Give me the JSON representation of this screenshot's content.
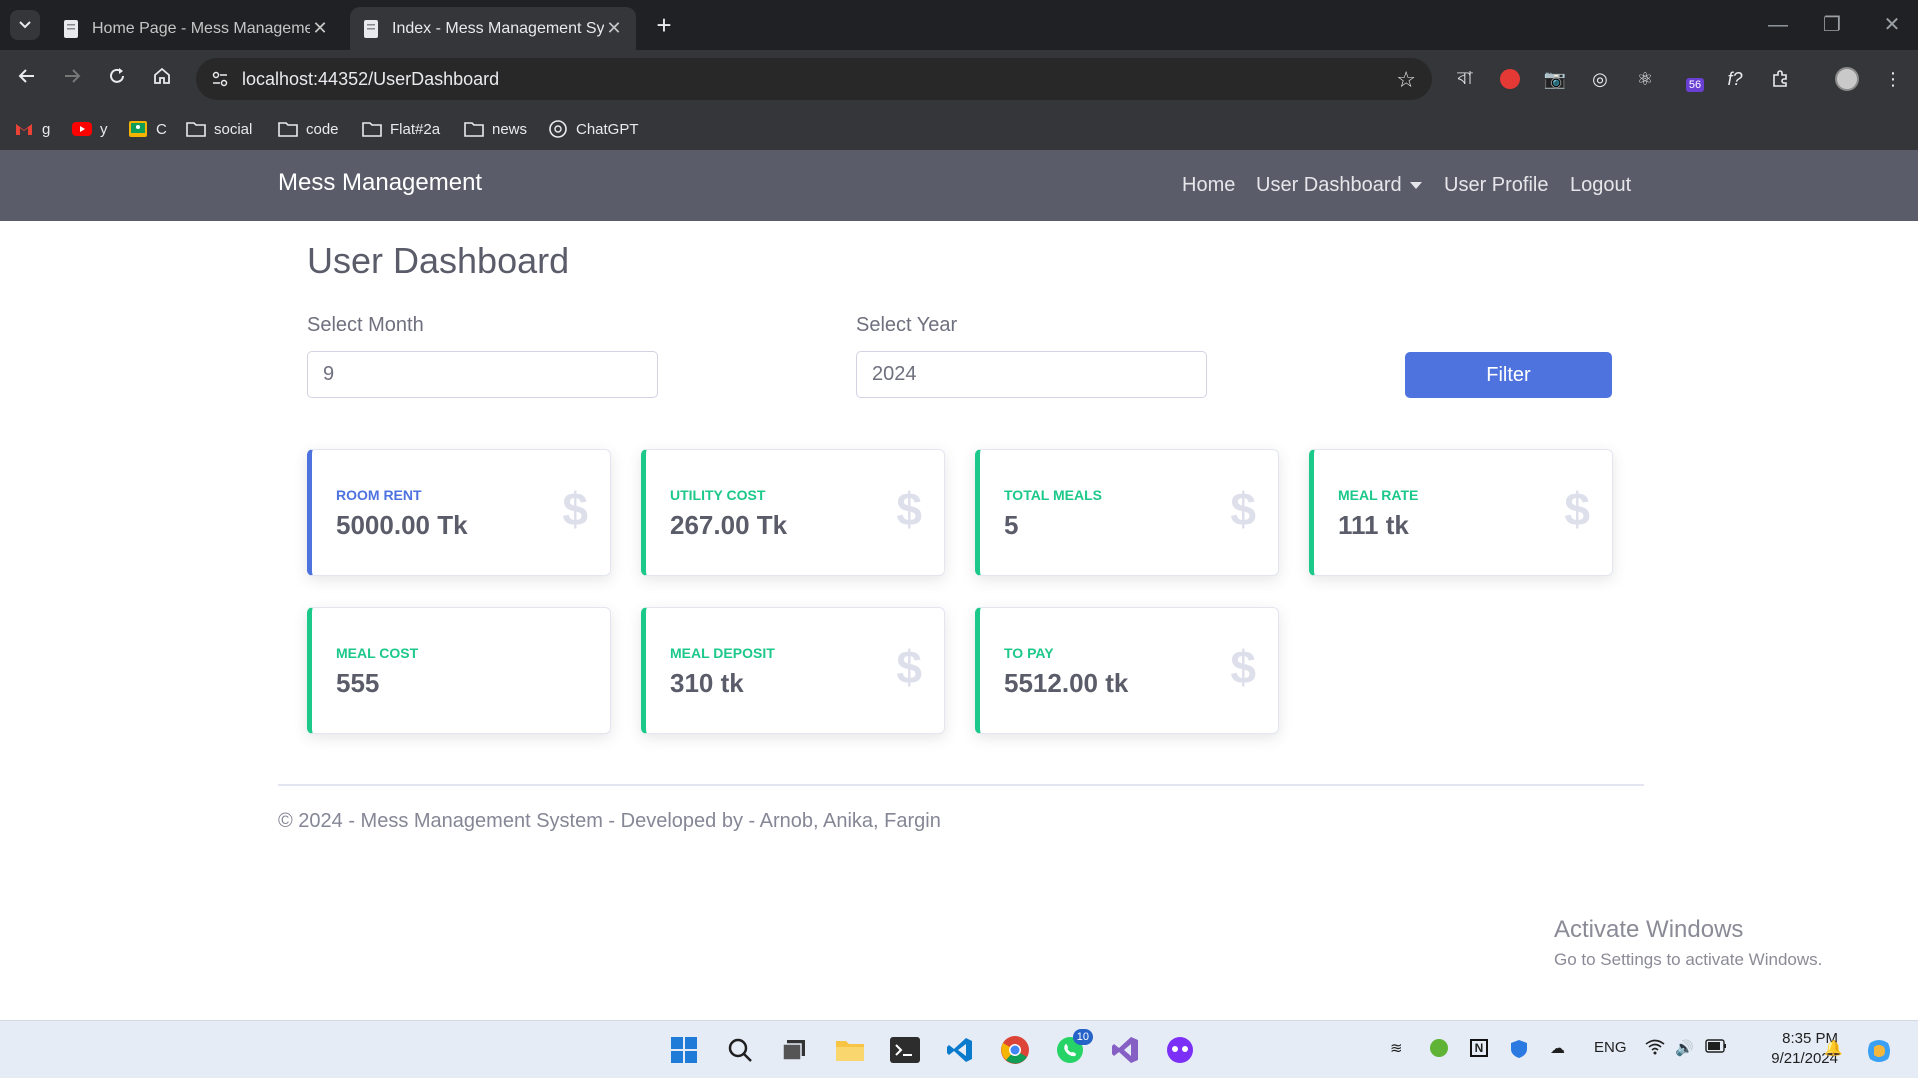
{
  "browser": {
    "tabs": [
      {
        "label": "Home Page - Mess Managemen",
        "active": false
      },
      {
        "label": "Index - Mess Management Syst",
        "active": true
      }
    ],
    "url": "localhost:44352/UserDashboard",
    "extension_badge": "56",
    "extension_text": "বা",
    "bookmarks": [
      {
        "label": "g",
        "icon": "gmail-icon"
      },
      {
        "label": "y",
        "icon": "youtube-icon"
      },
      {
        "label": "C",
        "icon": "classroom-icon"
      },
      {
        "label": "social",
        "icon": "folder-icon"
      },
      {
        "label": "code",
        "icon": "folder-icon"
      },
      {
        "label": "Flat#2a",
        "icon": "folder-icon"
      },
      {
        "label": "news",
        "icon": "folder-icon"
      },
      {
        "label": "ChatGPT",
        "icon": "chatgpt-icon"
      }
    ]
  },
  "app": {
    "brand": "Mess Management",
    "nav": {
      "home": "Home",
      "dashboard": "User Dashboard",
      "profile": "User Profile",
      "logout": "Logout"
    },
    "page_title": "User Dashboard",
    "filters": {
      "month_label": "Select Month",
      "month_value": "9",
      "year_label": "Select Year",
      "year_value": "2024",
      "button": "Filter"
    },
    "cards": [
      {
        "title": "Room Rent",
        "value": "5000.00 Tk",
        "accent": "#4e73df"
      },
      {
        "title": "Utility Cost",
        "value": "267.00 Tk",
        "accent": "#1cc88a"
      },
      {
        "title": "Total Meals",
        "value": "5",
        "accent": "#1cc88a"
      },
      {
        "title": "Meal Rate",
        "value": "111 tk",
        "accent": "#1cc88a"
      },
      {
        "title": "Meal Cost",
        "value": "555",
        "accent": "#1cc88a"
      },
      {
        "title": "Meal Deposit",
        "value": "310 tk",
        "accent": "#1cc88a"
      },
      {
        "title": "To Pay",
        "value": "5512.00 tk",
        "accent": "#1cc88a"
      }
    ],
    "card_icon": "$",
    "footer": "© 2024 - Mess Management System - Developed by - Arnob, Anika, Fargin"
  },
  "watermark": {
    "title": "Activate Windows",
    "subtitle": "Go to Settings to activate Windows."
  },
  "taskbar": {
    "whatsapp_badge": "10",
    "language": "ENG",
    "time": "8:35 PM",
    "date": "9/21/2024"
  }
}
